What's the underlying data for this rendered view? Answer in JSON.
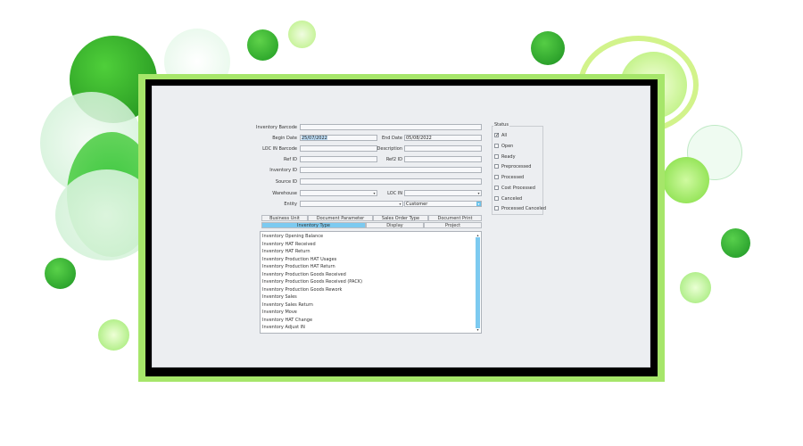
{
  "colors": {
    "accent": "#7ccaf0",
    "frame": "#a6e66a",
    "bezel": "#000000",
    "screen": "#eceef1"
  },
  "form": {
    "inventory_barcode": {
      "label": "Inventory Barcode",
      "value": ""
    },
    "begin_date": {
      "label": "Begin Date",
      "value": "25/07/2022"
    },
    "end_date": {
      "label": "End Date",
      "value": "05/08/2022"
    },
    "loc_in_barcode": {
      "label": "LOC IN Barcode",
      "value": ""
    },
    "description": {
      "label": "Description",
      "value": ""
    },
    "ref_id": {
      "label": "Ref ID",
      "value": ""
    },
    "ref2_id": {
      "label": "Ref2 ID",
      "value": ""
    },
    "inventory_id": {
      "label": "Inventory ID",
      "value": ""
    },
    "source_id": {
      "label": "Source ID",
      "value": ""
    },
    "warehouse": {
      "label": "Warehouse",
      "value": ""
    },
    "loc_in": {
      "label": "LOC IN",
      "value": ""
    },
    "entity": {
      "label": "Entity",
      "value": "",
      "type_value": "Customer"
    }
  },
  "status": {
    "title": "Status",
    "options": [
      {
        "label": "All",
        "checked": true
      },
      {
        "label": "Open",
        "checked": false
      },
      {
        "label": "Ready",
        "checked": false
      },
      {
        "label": "Preprocessed",
        "checked": false
      },
      {
        "label": "Processed",
        "checked": false
      },
      {
        "label": "Cost Processed",
        "checked": false
      },
      {
        "label": "Canceled",
        "checked": false
      },
      {
        "label": "Processed Canceled",
        "checked": false
      }
    ]
  },
  "tabs_row1": [
    "Business Unit",
    "Document Parameter",
    "Sales Order Type",
    "Document Print"
  ],
  "tabs_row2": [
    "Inventory Type",
    "Display",
    "Project"
  ],
  "inventory_types": [
    "Inventory Opening Balance",
    "Inventory HAT Received",
    "Inventory HAT Return",
    "Inventory Production HAT Usages",
    "Inventory Production HAT Return",
    "Inventory Production Goods Received",
    "Inventory Production Goods Received (PACK)",
    "Inventory Production Goods Rework",
    "Inventory Sales",
    "Inventory Sales Return",
    "Inventory Move",
    "Inventory HAT Change",
    "Inventory Adjust IN"
  ]
}
